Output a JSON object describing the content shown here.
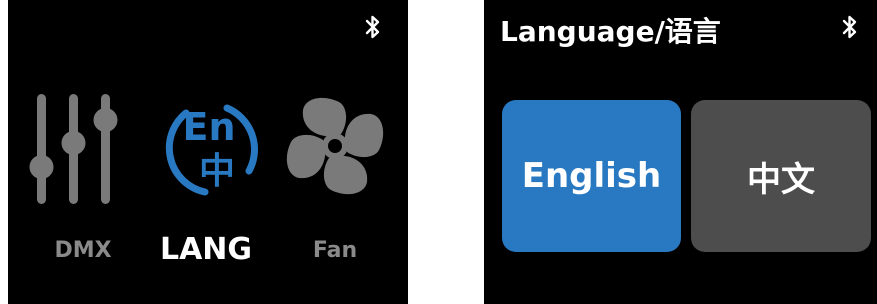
{
  "menu_screen": {
    "status": {
      "bluetooth_icon": "bluetooth-icon"
    },
    "items": [
      {
        "id": "dmx",
        "label": "DMX",
        "icon": "sliders-icon",
        "active": false
      },
      {
        "id": "lang",
        "label": "LANG",
        "icon": "language-icon",
        "active": true,
        "icon_text_top": "En",
        "icon_text_bottom": "中"
      },
      {
        "id": "fan",
        "label": "Fan",
        "icon": "fan-icon",
        "active": false
      }
    ]
  },
  "language_screen": {
    "title": "Language/语言",
    "status": {
      "bluetooth_icon": "bluetooth-icon"
    },
    "options": [
      {
        "id": "english",
        "label": "English",
        "selected": true
      },
      {
        "id": "chinese",
        "label": "中文",
        "selected": false
      }
    ]
  },
  "colors": {
    "background": "#000000",
    "accent": "#2979c2",
    "inactive_icon": "#7a7a7a",
    "inactive_label": "#8a8a8a",
    "unselected_button": "#4d4d4d",
    "text": "#ffffff"
  }
}
